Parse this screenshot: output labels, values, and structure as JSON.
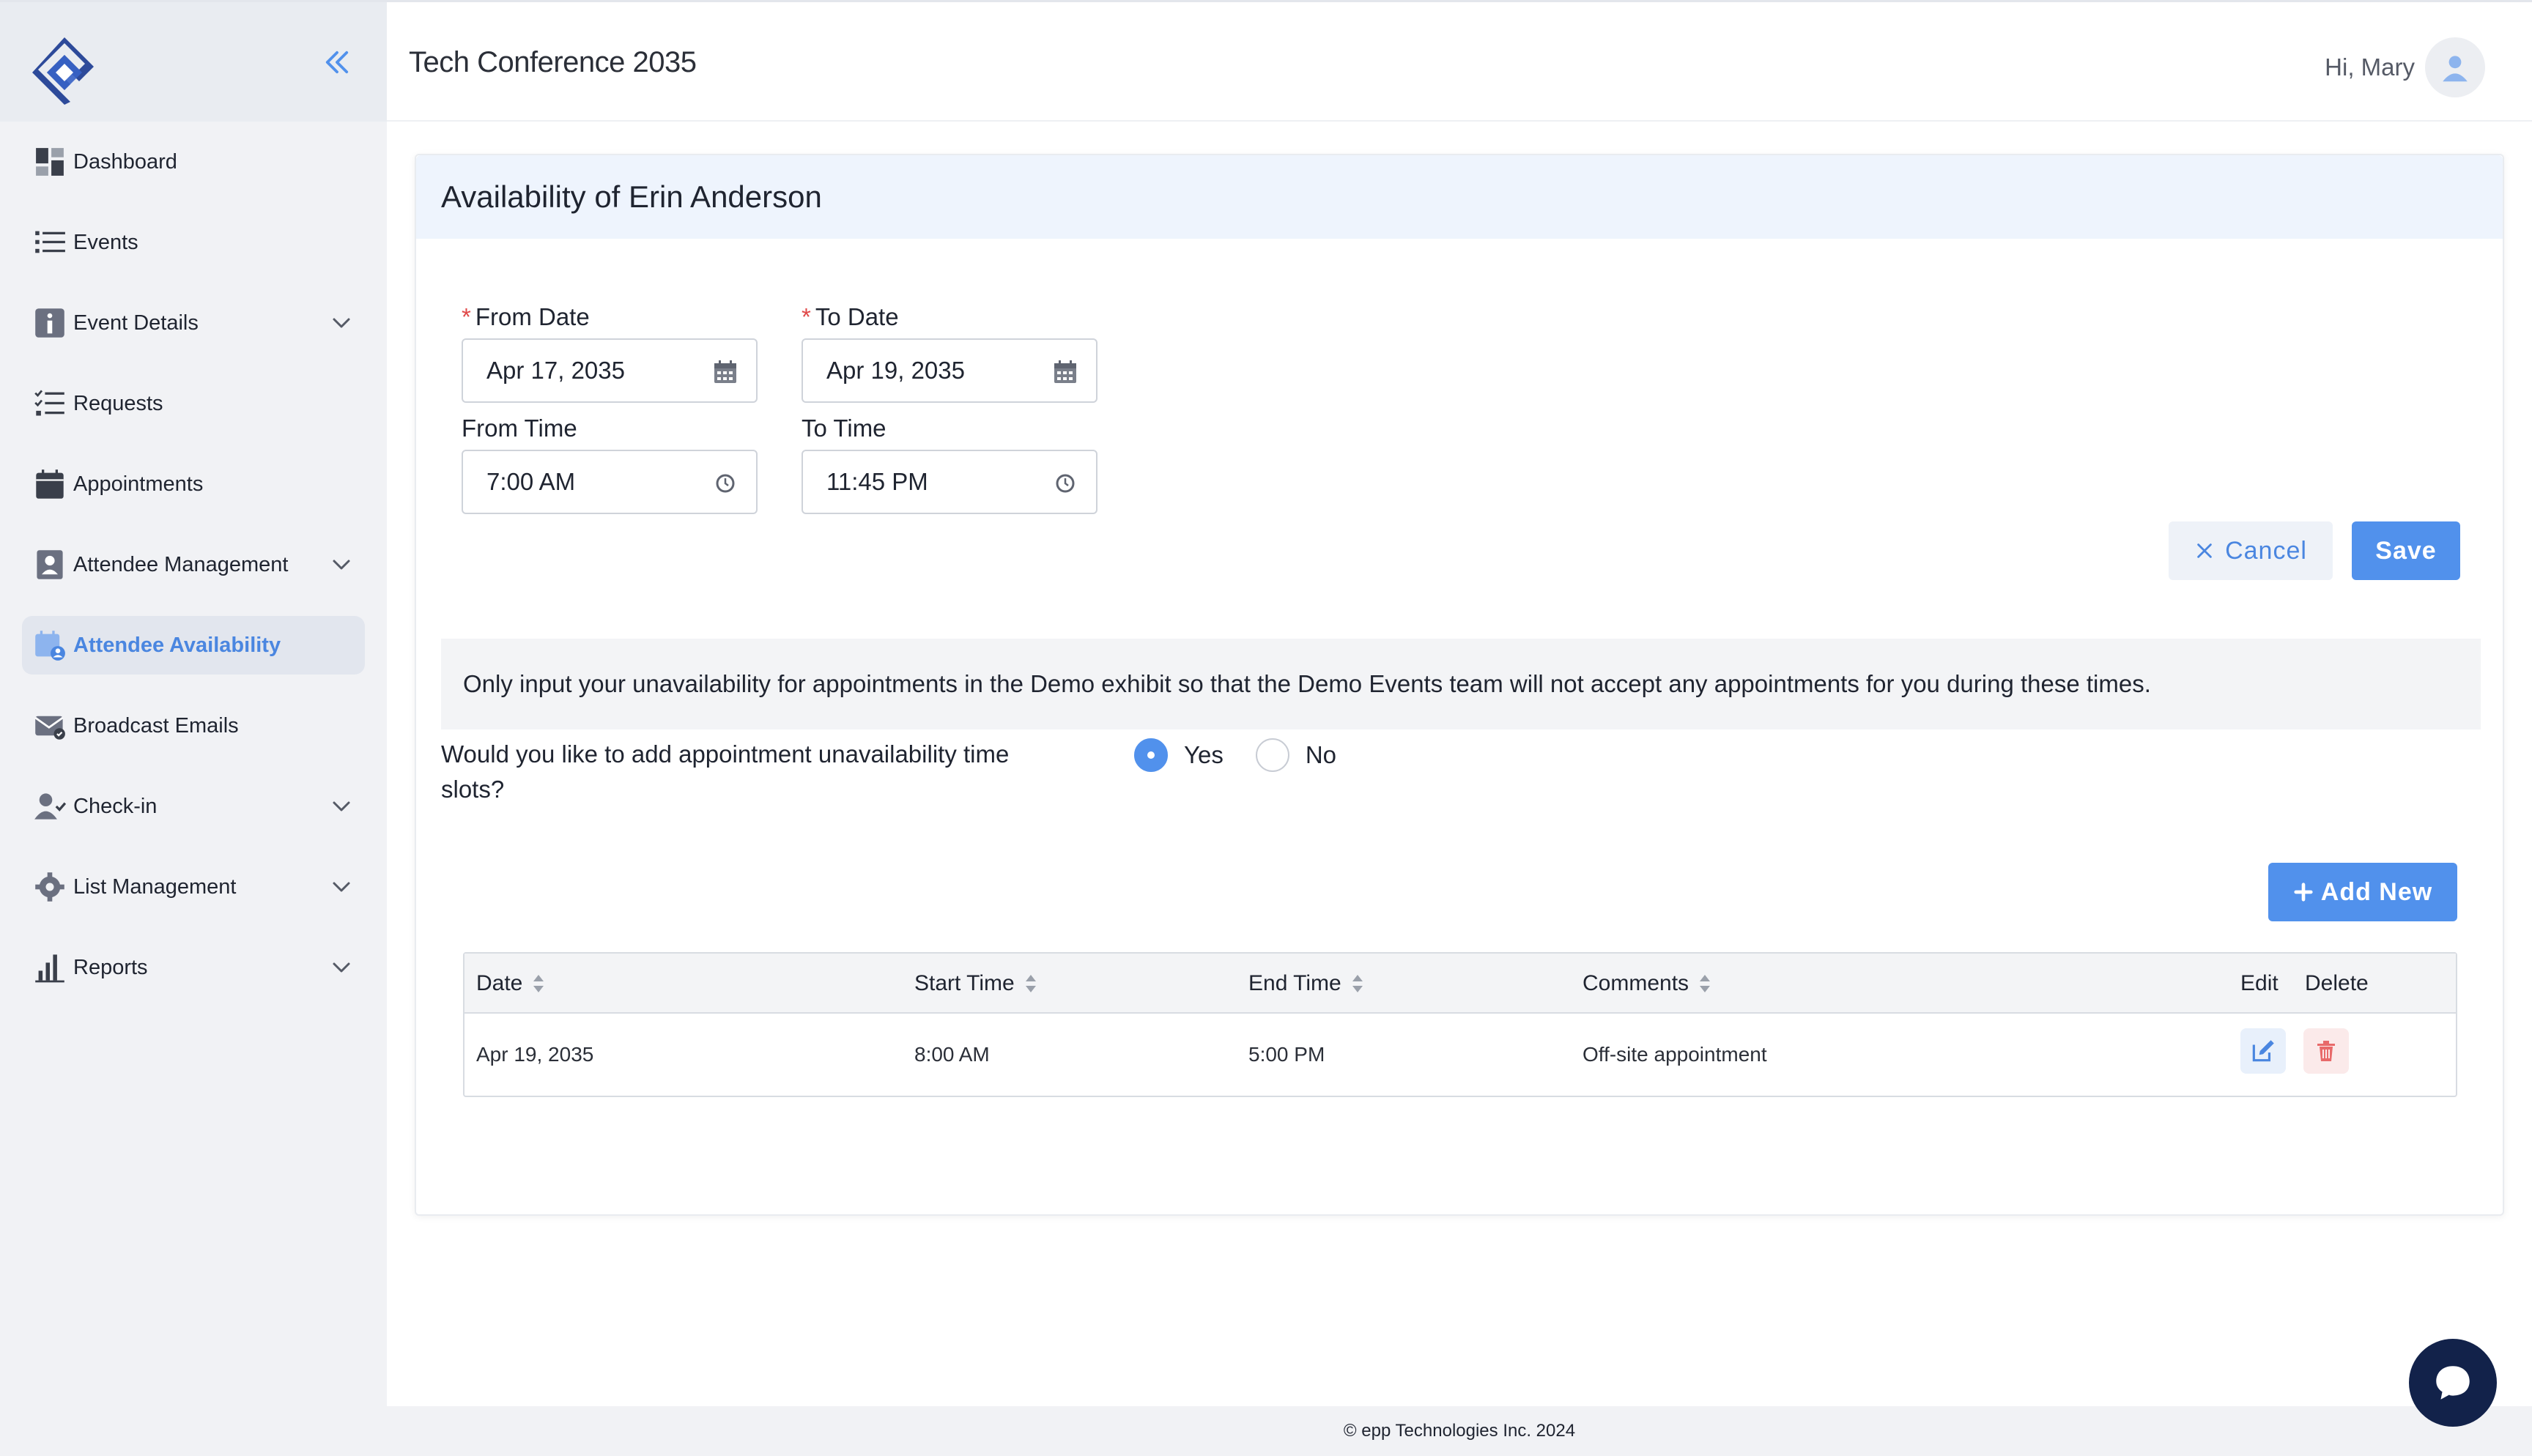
{
  "header": {
    "title": "Tech Conference 2035",
    "greeting": "Hi, Mary"
  },
  "sidebar": {
    "items": [
      {
        "label": "Dashboard",
        "icon": "dashboard-icon",
        "has_chevron": false,
        "active": false
      },
      {
        "label": "Events",
        "icon": "list-icon",
        "has_chevron": false,
        "active": false
      },
      {
        "label": "Event Details",
        "icon": "info-icon",
        "has_chevron": true,
        "active": false
      },
      {
        "label": "Requests",
        "icon": "checklist-icon",
        "has_chevron": false,
        "active": false
      },
      {
        "label": "Appointments",
        "icon": "calendar-icon",
        "has_chevron": false,
        "active": false
      },
      {
        "label": "Attendee Management",
        "icon": "contact-card-icon",
        "has_chevron": true,
        "active": false
      },
      {
        "label": "Attendee Availability",
        "icon": "calendar-user-icon",
        "has_chevron": false,
        "active": true
      },
      {
        "label": "Broadcast Emails",
        "icon": "mail-icon",
        "has_chevron": false,
        "active": false
      },
      {
        "label": "Check-in",
        "icon": "user-check-icon",
        "has_chevron": true,
        "active": false
      },
      {
        "label": "List Management",
        "icon": "gear-icon",
        "has_chevron": true,
        "active": false
      },
      {
        "label": "Reports",
        "icon": "bar-chart-icon",
        "has_chevron": true,
        "active": false
      }
    ]
  },
  "card": {
    "title": "Availability of Erin Anderson",
    "from_date": {
      "label": "From Date",
      "value": "Apr 17, 2035",
      "required": true
    },
    "to_date": {
      "label": "To Date",
      "value": "Apr 19, 2035",
      "required": true
    },
    "from_time": {
      "label": "From Time",
      "value": "7:00 AM"
    },
    "to_time": {
      "label": "To Time",
      "value": "11:45 PM"
    },
    "cancel_label": "Cancel",
    "save_label": "Save",
    "notice": "Only input your unavailability for appointments in the Demo exhibit so that the Demo Events team will not accept any appointments for you during these times.",
    "question": "Would you like to add appointment unavailability time slots?",
    "radio": {
      "yes": "Yes",
      "no": "No",
      "selected": "yes"
    },
    "add_new_label": "Add New"
  },
  "table": {
    "columns": {
      "date": "Date",
      "start_time": "Start Time",
      "end_time": "End Time",
      "comments": "Comments",
      "edit": "Edit",
      "delete": "Delete"
    },
    "rows": [
      {
        "date": "Apr 19, 2035",
        "start_time": "8:00 AM",
        "end_time": "5:00 PM",
        "comments": "Off-site appointment"
      }
    ]
  },
  "footer": {
    "text": "© epp Technologies Inc. 2024"
  },
  "colors": {
    "accent": "#5191ec",
    "sidebar_bg": "#f1f2f5",
    "required": "#e04848",
    "chat_fab": "#12224a"
  }
}
